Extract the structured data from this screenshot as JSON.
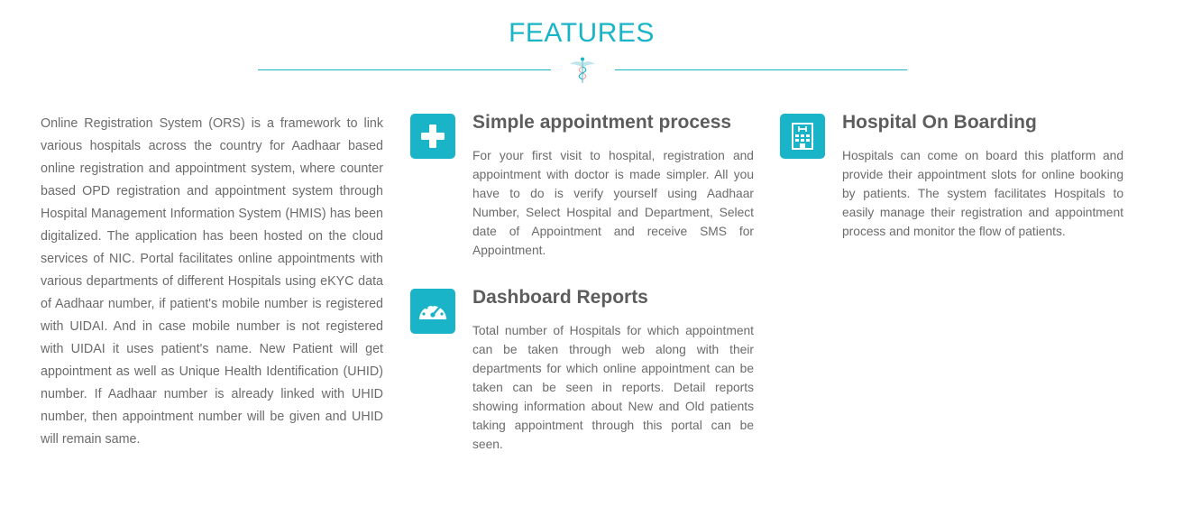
{
  "section": {
    "title": "FEATURES",
    "brand_color": "#1ab4c8"
  },
  "intro": {
    "text": "Online Registration System (ORS) is a framework to link various hospitals across the country for Aadhaar based online registration and appointment system, where counter based OPD registration and appointment system through Hospital Management Information System (HMIS) has been digitalized. The application has been hosted on the cloud services of NIC. Portal facilitates online appointments with various departments of different Hospitals using eKYC data of Aadhaar number, if patient's mobile number is registered with UIDAI. And in case mobile number is not registered with UIDAI it uses patient's name. New Patient will get appointment as well as Unique Health Identification (UHID) number. If Aadhaar number is already linked with UHID number, then appointment number will be given and UHID will remain same."
  },
  "features": [
    {
      "icon": "plus-icon",
      "title": "Simple appointment process",
      "body": "For your first visit to hospital, registration and appointment with doctor is made simpler. All you have to do is verify yourself using Aadhaar Number, Select Hospital and Department, Select date of Appointment and receive SMS for Appointment."
    },
    {
      "icon": "hospital-building-icon",
      "title": "Hospital On Boarding",
      "body": "Hospitals can come on board this platform and provide their appointment slots for online booking by patients. The system facilitates Hospitals to easily manage their registration and appointment process and monitor the flow of patients."
    },
    {
      "icon": "dashboard-gauge-icon",
      "title": "Dashboard Reports",
      "body": "Total number of Hospitals for which appointment can be taken through web along with their departments for which online appointment can be taken can be seen in reports. Detail reports showing information about New and Old patients taking appointment through this portal can be seen."
    }
  ]
}
